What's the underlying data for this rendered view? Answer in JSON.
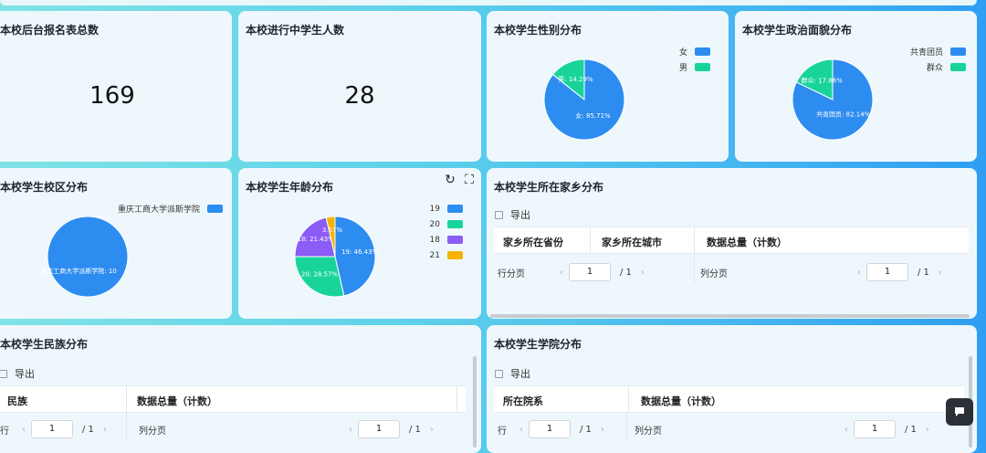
{
  "cards": {
    "signup_total": {
      "title": "本校后台报名表总数",
      "value": "169"
    },
    "active_students": {
      "title": "本校进行中学生人数",
      "value": "28"
    },
    "gender": {
      "title": "本校学生性别分布",
      "legend": [
        "女",
        "男"
      ],
      "labels": [
        "女: 85.71%",
        "男: 14.29%"
      ]
    },
    "political": {
      "title": "本校学生政治面貌分布",
      "legend": [
        "共青团员",
        "群众"
      ],
      "labels": [
        "共青团员: 82.14%",
        "群众: 17.86%"
      ]
    },
    "campus": {
      "title": "本校学生校区分布",
      "legend": [
        "重庆工商大学派斯学院"
      ],
      "labels": [
        "重庆工商大学派斯学院: 10"
      ]
    },
    "age": {
      "title": "本校学生年龄分布",
      "legend": [
        "19",
        "20",
        "18",
        "21"
      ],
      "labels": [
        "19: 46.43%",
        "20: 28.57%",
        "18: 21.43%",
        "3.57%"
      ]
    },
    "hometown": {
      "title": "本校学生所在家乡分布",
      "export": "导出",
      "columns": [
        "家乡所在省份",
        "家乡所在城市",
        "数据总量（计数）"
      ],
      "pager_left": {
        "label": "行分页",
        "page": "1",
        "total": "/ 1"
      },
      "pager_right": {
        "label": "列分页",
        "page": "1",
        "total": "/ 1"
      }
    },
    "ethnic": {
      "title": "本校学生民族分布",
      "export": "导出",
      "columns": [
        "民族",
        "数据总量（计数）"
      ],
      "pager_left": {
        "label": "行",
        "page": "1",
        "total": "/ 1"
      },
      "pager_right": {
        "label": "列分页",
        "page": "1",
        "total": "/ 1"
      }
    },
    "college": {
      "title": "本校学生学院分布",
      "export": "导出",
      "columns": [
        "所在院系",
        "数据总量（计数）"
      ],
      "pager_left": {
        "label": "行",
        "page": "1",
        "total": "/ 1"
      },
      "pager_right": {
        "label": "列分页",
        "page": "1",
        "total": "/ 1"
      }
    }
  },
  "chart_data": [
    {
      "type": "pie",
      "title": "本校学生性别分布",
      "categories": [
        "女",
        "男"
      ],
      "values": [
        85.71,
        14.29
      ],
      "colors": [
        "#2d8cf0",
        "#19d49a"
      ]
    },
    {
      "type": "pie",
      "title": "本校学生政治面貌分布",
      "categories": [
        "共青团员",
        "群众"
      ],
      "values": [
        82.14,
        17.86
      ],
      "colors": [
        "#2d8cf0",
        "#19d49a"
      ]
    },
    {
      "type": "pie",
      "title": "本校学生校区分布",
      "categories": [
        "重庆工商大学派斯学院"
      ],
      "values": [
        10
      ],
      "colors": [
        "#2d8cf0"
      ]
    },
    {
      "type": "pie",
      "title": "本校学生年龄分布",
      "categories": [
        "19",
        "20",
        "18",
        "21"
      ],
      "values": [
        46.43,
        28.57,
        21.43,
        3.57
      ],
      "colors": [
        "#2d8cf0",
        "#19d49a",
        "#8b5cf6",
        "#f5b400"
      ]
    }
  ]
}
